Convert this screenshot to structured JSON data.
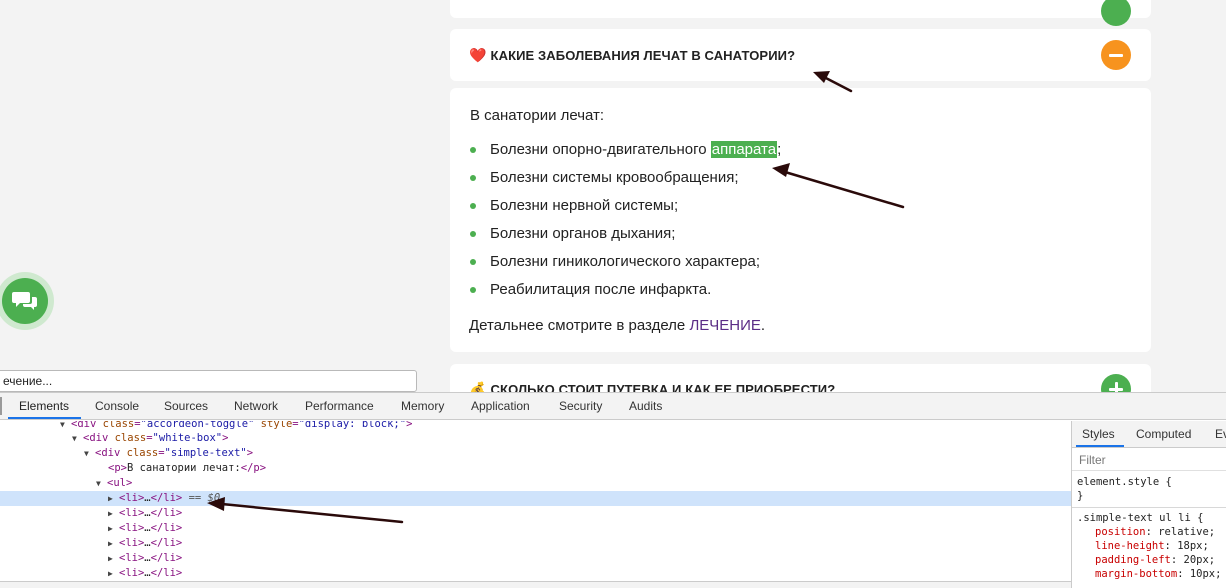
{
  "page": {
    "question_1": {
      "emoji": "❤️",
      "title": "КАКИЕ ЗАБОЛЕВАНИЯ ЛЕЧАТ В САНАТОРИИ?"
    },
    "answer": {
      "intro": "В санатории лечат:",
      "items": [
        {
          "before": "Болезни опорно-двигательного ",
          "highlight": "аппарата",
          "after": ";"
        },
        {
          "before": "Болезни системы кровообращения;",
          "highlight": "",
          "after": ""
        },
        {
          "before": "Болезни нервной системы;",
          "highlight": "",
          "after": ""
        },
        {
          "before": "Болезни органов дыхания;",
          "highlight": "",
          "after": ""
        },
        {
          "before": "Болезни гиникологического характера;",
          "highlight": "",
          "after": ""
        },
        {
          "before": "Реабилитация после инфаркта.",
          "highlight": "",
          "after": ""
        }
      ],
      "detail_text": "Детальнее смотрите в разделе ",
      "detail_link": "ЛЕЧЕНИЕ",
      "detail_end": "."
    },
    "question_2": {
      "emoji": "💰",
      "title": "СКОЛЬКО СТОИТ ПУТЕВКА И КАК ЕЕ ПРИОБРЕСТИ?"
    },
    "search_popup_text": "ечение...",
    "colors": {
      "accent_green": "#4caf50",
      "minus_orange": "#f7931e",
      "link_purple": "#5b2d86"
    }
  },
  "devtools": {
    "tabs": [
      "Elements",
      "Console",
      "Sources",
      "Network",
      "Performance",
      "Memory",
      "Application",
      "Security",
      "Audits"
    ],
    "active_tab": "Elements",
    "dom": [
      {
        "tri": "▼",
        "open": "<div ",
        "a1": "class",
        "v1": "\"accordeon-toggle\"",
        "a2": "style",
        "v2": "\"display: block;\"",
        "close": ">"
      },
      {
        "tri": "▼",
        "open": "<div ",
        "a1": "class",
        "v1": "\"white-box\"",
        "a2": "",
        "v2": "",
        "close": ">"
      },
      {
        "tri": "▼",
        "open": "<div ",
        "a1": "class",
        "v1": "\"simple-text\"",
        "a2": "",
        "v2": "",
        "close": ">"
      },
      {
        "tri": "",
        "open": "<p>",
        "text": "В санатории лечат:",
        "end": "</p>"
      },
      {
        "tri": "▼",
        "open": "<ul>"
      },
      {
        "tri": "▶",
        "open": "<li>",
        "text": "…",
        "end": "</li>",
        "marker": "== $0"
      },
      {
        "tri": "▶",
        "open": "<li>",
        "text": "…",
        "end": "</li>"
      },
      {
        "tri": "▶",
        "open": "<li>",
        "text": "…",
        "end": "</li>"
      },
      {
        "tri": "▶",
        "open": "<li>",
        "text": "…",
        "end": "</li>"
      },
      {
        "tri": "▶",
        "open": "<li>",
        "text": "…",
        "end": "</li>"
      },
      {
        "tri": "▶",
        "open": "<li>",
        "text": "…",
        "end": "</li>"
      }
    ],
    "styles_tabs": [
      "Styles",
      "Computed",
      "Ev"
    ],
    "filter_placeholder": "Filter",
    "rules": {
      "element_style": "element.style {",
      "element_style_close": "}",
      "selector": ".simple-text ul li {",
      "props": [
        {
          "name": "position",
          "value": "relative;"
        },
        {
          "name": "line-height",
          "value": "18px;"
        },
        {
          "name": "padding-left",
          "value": "20px;"
        },
        {
          "name": "margin-bottom",
          "value": "10px;"
        }
      ]
    }
  }
}
